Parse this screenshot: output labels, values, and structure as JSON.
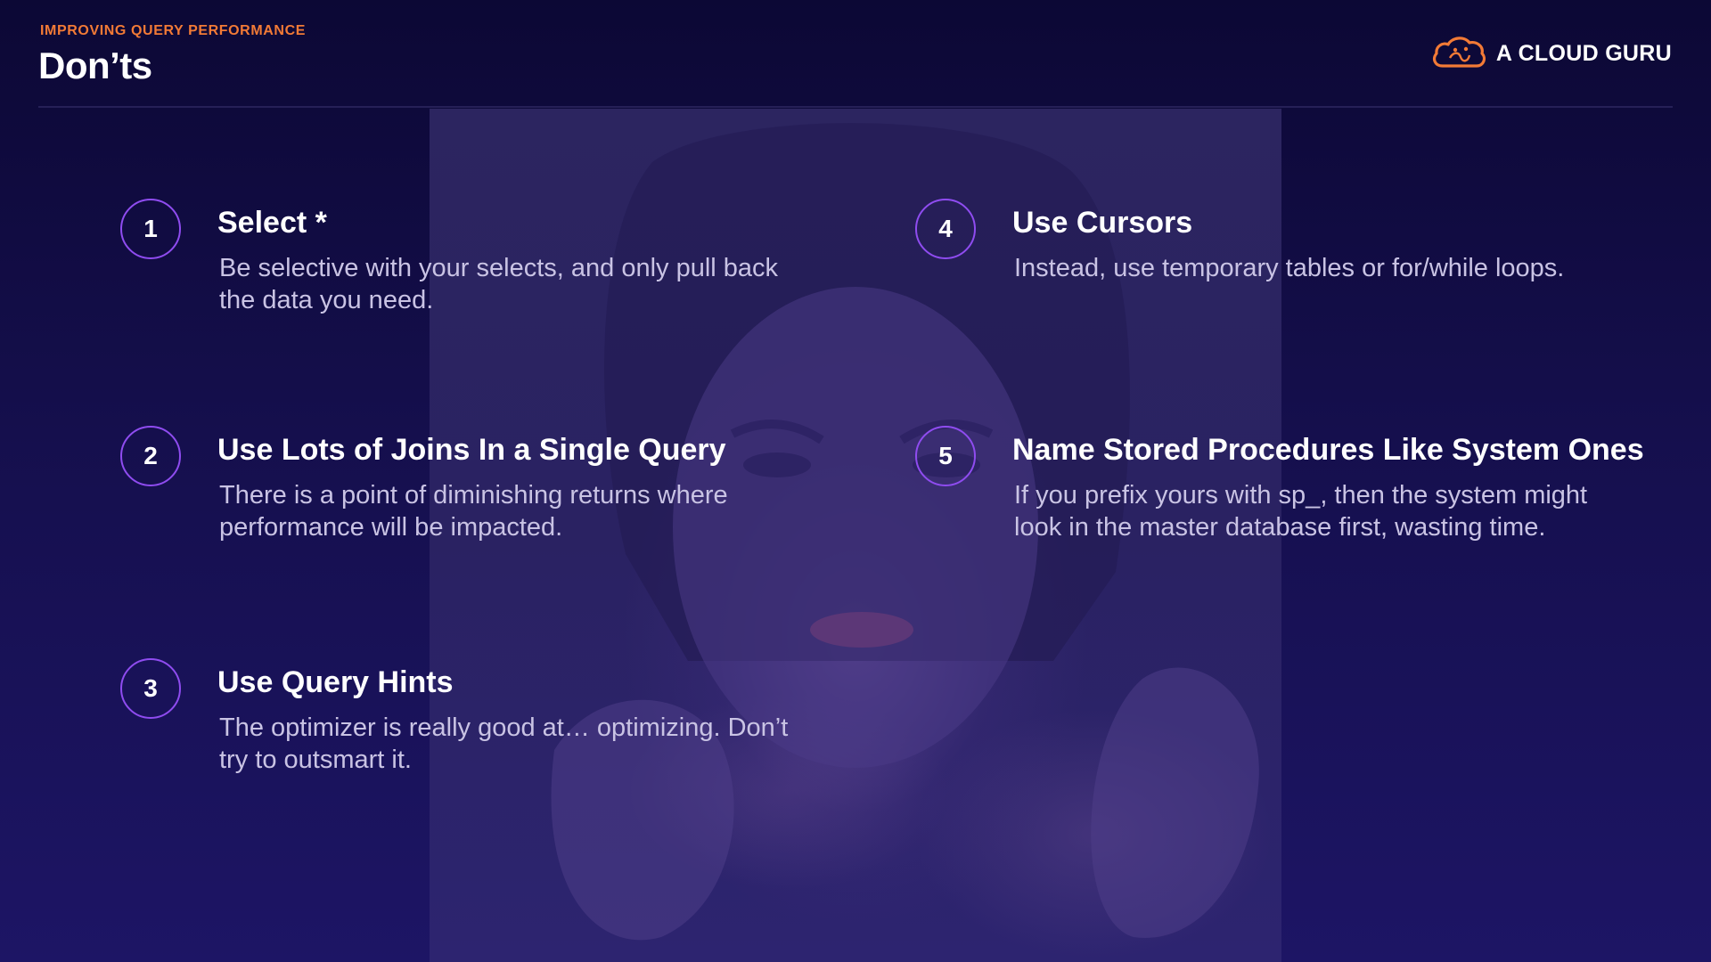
{
  "slide": {
    "eyebrow": "IMPROVING QUERY PERFORMANCE",
    "title": "Don’ts"
  },
  "brand": {
    "name": "A CLOUD GURU",
    "icon": "cloud-icon",
    "accent_color": "#f27a36"
  },
  "items": [
    {
      "number": "1",
      "heading": "Select *",
      "body": "Be selective with your selects, and only pull back the data you need."
    },
    {
      "number": "2",
      "heading": "Use Lots of Joins In a Single Query",
      "body": "There is a point of diminishing returns where performance will be impacted."
    },
    {
      "number": "3",
      "heading": "Use Query Hints",
      "body": "The optimizer is really good at… optimizing. Don’t try to outsmart it."
    },
    {
      "number": "4",
      "heading": "Use Cursors",
      "body": "Instead, use temporary tables or for/while loops."
    },
    {
      "number": "5",
      "heading": "Name Stored Procedures Like System Ones",
      "body": "If you prefix yours with sp_, then the system might look in the master database first, wasting time."
    }
  ],
  "colors": {
    "background": "#140e4a",
    "badge_ring": "#8f4cf0",
    "body_text": "#c9c3e4"
  }
}
